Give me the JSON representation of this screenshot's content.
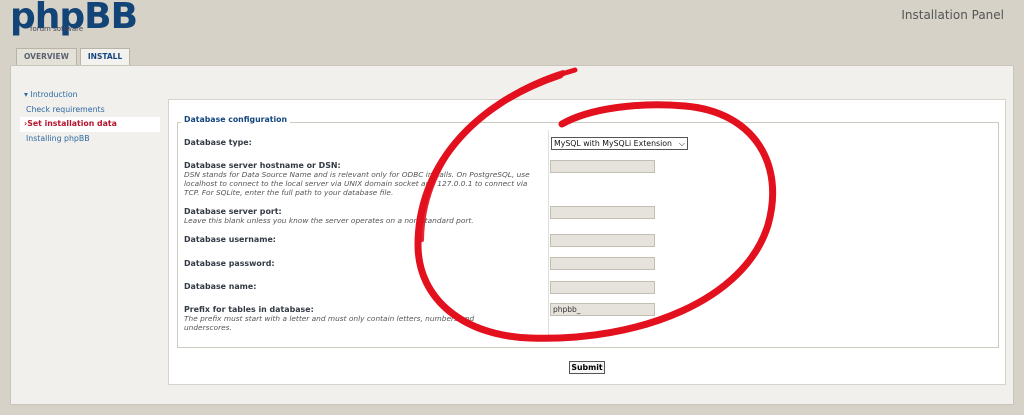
{
  "header": {
    "logo_text": "phpBB",
    "logo_subtext": "forum     software",
    "panel_title": "Installation Panel"
  },
  "tabs": [
    {
      "label": "OVERVIEW",
      "active": false
    },
    {
      "label": "INSTALL",
      "active": true
    }
  ],
  "sidebar": {
    "items": [
      {
        "label": "Introduction",
        "active": false
      },
      {
        "label": "Check requirements",
        "active": false
      },
      {
        "label": "Set installation data",
        "active": true
      },
      {
        "label": "Installing phpBB",
        "active": false
      }
    ]
  },
  "form": {
    "legend": "Database configuration",
    "db_type": {
      "label": "Database type:",
      "selected": "MySQL with MySQLi Extension"
    },
    "hostname": {
      "label": "Database server hostname or DSN:",
      "description": "DSN stands for Data Source Name and is relevant only for ODBC installs. On PostgreSQL, use localhost to connect to the local server via UNIX domain socket and 127.0.0.1 to connect via TCP. For SQLite, enter the full path to your database file.",
      "value": ""
    },
    "port": {
      "label": "Database server port:",
      "description": "Leave this blank unless you know the server operates on a non-standard port.",
      "value": ""
    },
    "username": {
      "label": "Database username:",
      "value": ""
    },
    "password": {
      "label": "Database password:",
      "value": ""
    },
    "dbname": {
      "label": "Database name:",
      "value": ""
    },
    "prefix": {
      "label": "Prefix for tables in database:",
      "description": "The prefix must start with a letter and must only contain letters, numbers and underscores.",
      "value": "phpbb_"
    },
    "submit_label": "Submit"
  },
  "colors": {
    "brand": "#124477",
    "active_sidebar": "#b5132e",
    "annotation_circle": "#e3101e"
  }
}
